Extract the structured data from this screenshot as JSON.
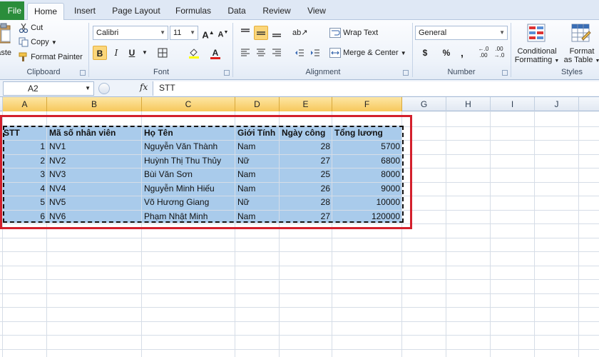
{
  "tabs": {
    "file": "File",
    "items": [
      "Home",
      "Insert",
      "Page Layout",
      "Formulas",
      "Data",
      "Review",
      "View"
    ],
    "active": "Home"
  },
  "ribbon": {
    "clipboard": {
      "paste_label": "Paste",
      "cut": "Cut",
      "copy": "Copy",
      "format_painter": "Format Painter",
      "group": "Clipboard"
    },
    "font": {
      "name": "Calibri",
      "size": "11",
      "group": "Font"
    },
    "alignment": {
      "wrap_text": "Wrap Text",
      "merge_center": "Merge & Center",
      "group": "Alignment"
    },
    "number": {
      "format": "General",
      "currency": "$",
      "percent": "%",
      "comma": ",",
      "group": "Number"
    },
    "styles": {
      "conditional": [
        "Conditional",
        "Formatting"
      ],
      "format_table": [
        "Format",
        "as Table"
      ],
      "group": "Styles"
    }
  },
  "formula_bar": {
    "name_box": "A2",
    "fx": "fx",
    "content": "STT"
  },
  "sheet": {
    "columns": [
      "A",
      "B",
      "C",
      "D",
      "E",
      "F",
      "G",
      "H",
      "I",
      "J"
    ],
    "selected_columns": [
      "A",
      "B",
      "C",
      "D",
      "E",
      "F"
    ],
    "header": [
      "STT",
      "Mã số nhân viên",
      "Họ Tên",
      "Giới Tính",
      "Ngày công",
      "Tổng lương"
    ],
    "rows": [
      [
        "1",
        "NV1",
        "Nguyễn Văn Thành",
        "Nam",
        "28",
        "5700"
      ],
      [
        "2",
        "NV2",
        "Huỳnh Thị Thu Thủy",
        "Nữ",
        "27",
        "6800"
      ],
      [
        "3",
        "NV3",
        "Bùi Văn Sơn",
        "Nam",
        "25",
        "8000"
      ],
      [
        "4",
        "NV4",
        "Nguyễn Minh Hiếu",
        "Nam",
        "26",
        "9000"
      ],
      [
        "5",
        "NV5",
        "Võ Hương Giang",
        "Nữ",
        "28",
        "10000"
      ],
      [
        "6",
        "NV6",
        "Phạm Nhật Minh",
        "Nam",
        "27",
        "120000"
      ]
    ]
  },
  "colors": {
    "selection": "#a9cbeb",
    "highlight_border": "#d3202c",
    "file_tab": "#2a8d3b"
  }
}
